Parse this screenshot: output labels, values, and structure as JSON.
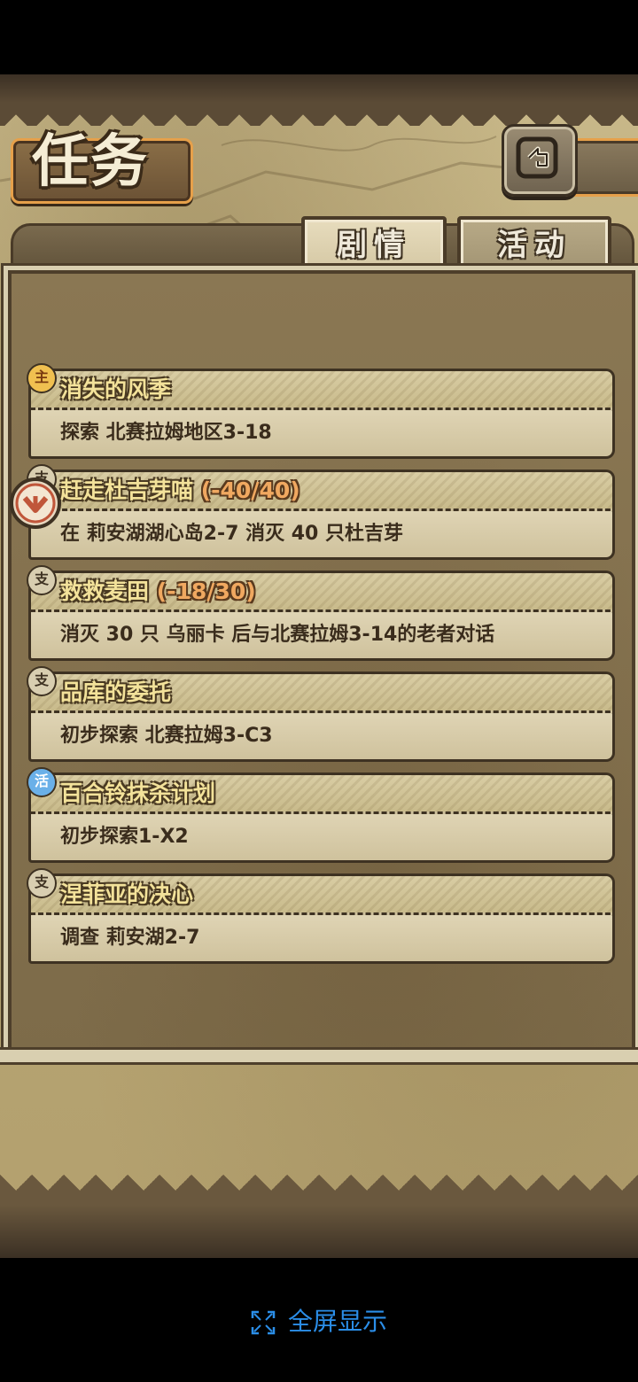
{
  "screen": {
    "title": "任务",
    "back_icon": "back-arrow-icon"
  },
  "tabs": [
    {
      "label": "剧情",
      "active": true
    },
    {
      "label": "活动",
      "active": false
    }
  ],
  "quests": [
    {
      "type_badge": "主",
      "type": "main",
      "name": "消失的风季",
      "progress": "",
      "description": "探索 北赛拉姆地区3-18"
    },
    {
      "type_badge": "支",
      "type": "side",
      "name": "赶走杜吉芽喵",
      "progress": " (-40/40)",
      "description": "在 莉安湖湖心岛2-7 消灭 40 只杜吉芽",
      "selected": true
    },
    {
      "type_badge": "支",
      "type": "side",
      "name": "救救麦田",
      "progress": " (-18/30)",
      "description": "消灭 30 只 乌丽卡 后与北赛拉姆3-14的老者对话"
    },
    {
      "type_badge": "支",
      "type": "side",
      "name": "品库的委托",
      "progress": "",
      "description": "初步探索 北赛拉姆3-C3"
    },
    {
      "type_badge": "活",
      "type": "activity",
      "name": "百合铃抹杀计划",
      "progress": "",
      "description": "初步探索1-X2"
    },
    {
      "type_badge": "支",
      "type": "side",
      "name": "涅菲亚的决心",
      "progress": "",
      "description": "调查 莉安湖2-7"
    }
  ],
  "footer": {
    "fullscreen_label": "全屏显示",
    "fullscreen_icon": "fullscreen-icon",
    "accent": "#2b8ee8"
  }
}
